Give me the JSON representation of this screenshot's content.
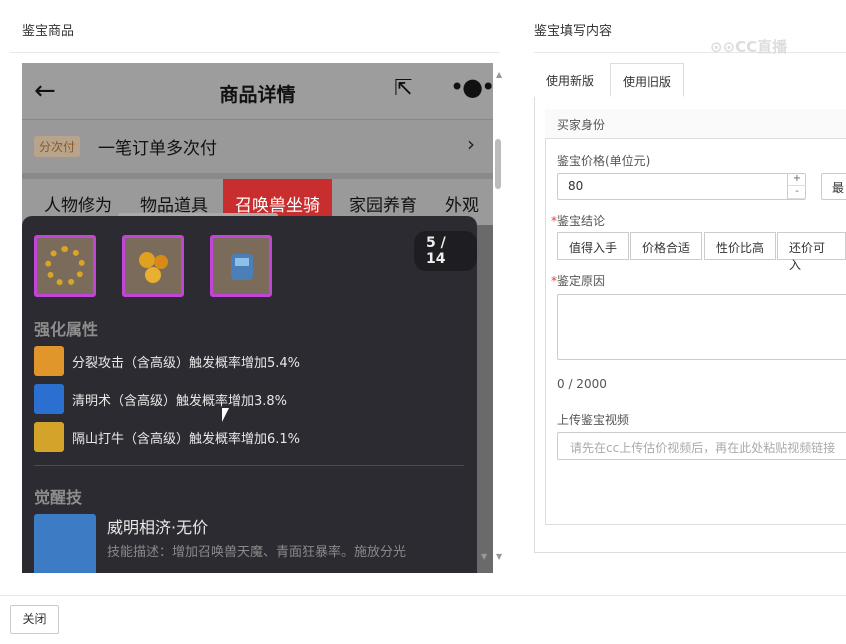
{
  "left_section_title": "鉴宝商品",
  "right_section_title": "鉴宝填写内容",
  "watermark": "⊙⊙CC直播",
  "phone": {
    "back_icon": "←",
    "title": "商品详情",
    "share_icon": "⇱",
    "more_icon": "•●•",
    "pay_badge": "分次付",
    "pay_text": "一笔订单多次付",
    "pay_chevron": "›",
    "tabs": [
      "人物修为",
      "物品道具",
      "召唤兽坐骑",
      "家园养育",
      "外观"
    ],
    "active_tab": "召唤兽坐骑",
    "pager": "5 / 14",
    "section_enhance": "强化属性",
    "attributes": [
      {
        "text": "分裂攻击（含高级）触发概率增加5.4%",
        "icon": "fire-claw-icon",
        "color": "#e0962a"
      },
      {
        "text": "清明术（含高级）触发概率增加3.8%",
        "icon": "blue-orb-icon",
        "color": "#2b6fd1"
      },
      {
        "text": "隔山打牛（含高级）触发概率增加6.1%",
        "icon": "golden-strike-icon",
        "color": "#d4a32a"
      }
    ],
    "section_awaken": "觉醒技",
    "skill_name": "威明相济·无价",
    "skill_desc": "技能描述：增加召唤兽天魔、青面狂暴率。施放分光"
  },
  "form": {
    "tab_new": "使用新版",
    "tab_old": "使用旧版",
    "buyer_identity": "买家身份",
    "price_label": "鉴宝价格(单位元)",
    "price_value": "80",
    "stepper_up": "+",
    "stepper_down": "-",
    "max_btn": "最",
    "conclusion_label": "鉴宝结论",
    "conclusion_options": [
      "值得入手",
      "价格合适",
      "性价比高",
      "还价可入"
    ],
    "reason_label": "鉴定原因",
    "counter": "0 / 2000",
    "video_label": "上传鉴宝视频",
    "video_placeholder": "请先在cc上传估价视频后，再在此处粘贴视频链接"
  },
  "close_button": "关闭"
}
